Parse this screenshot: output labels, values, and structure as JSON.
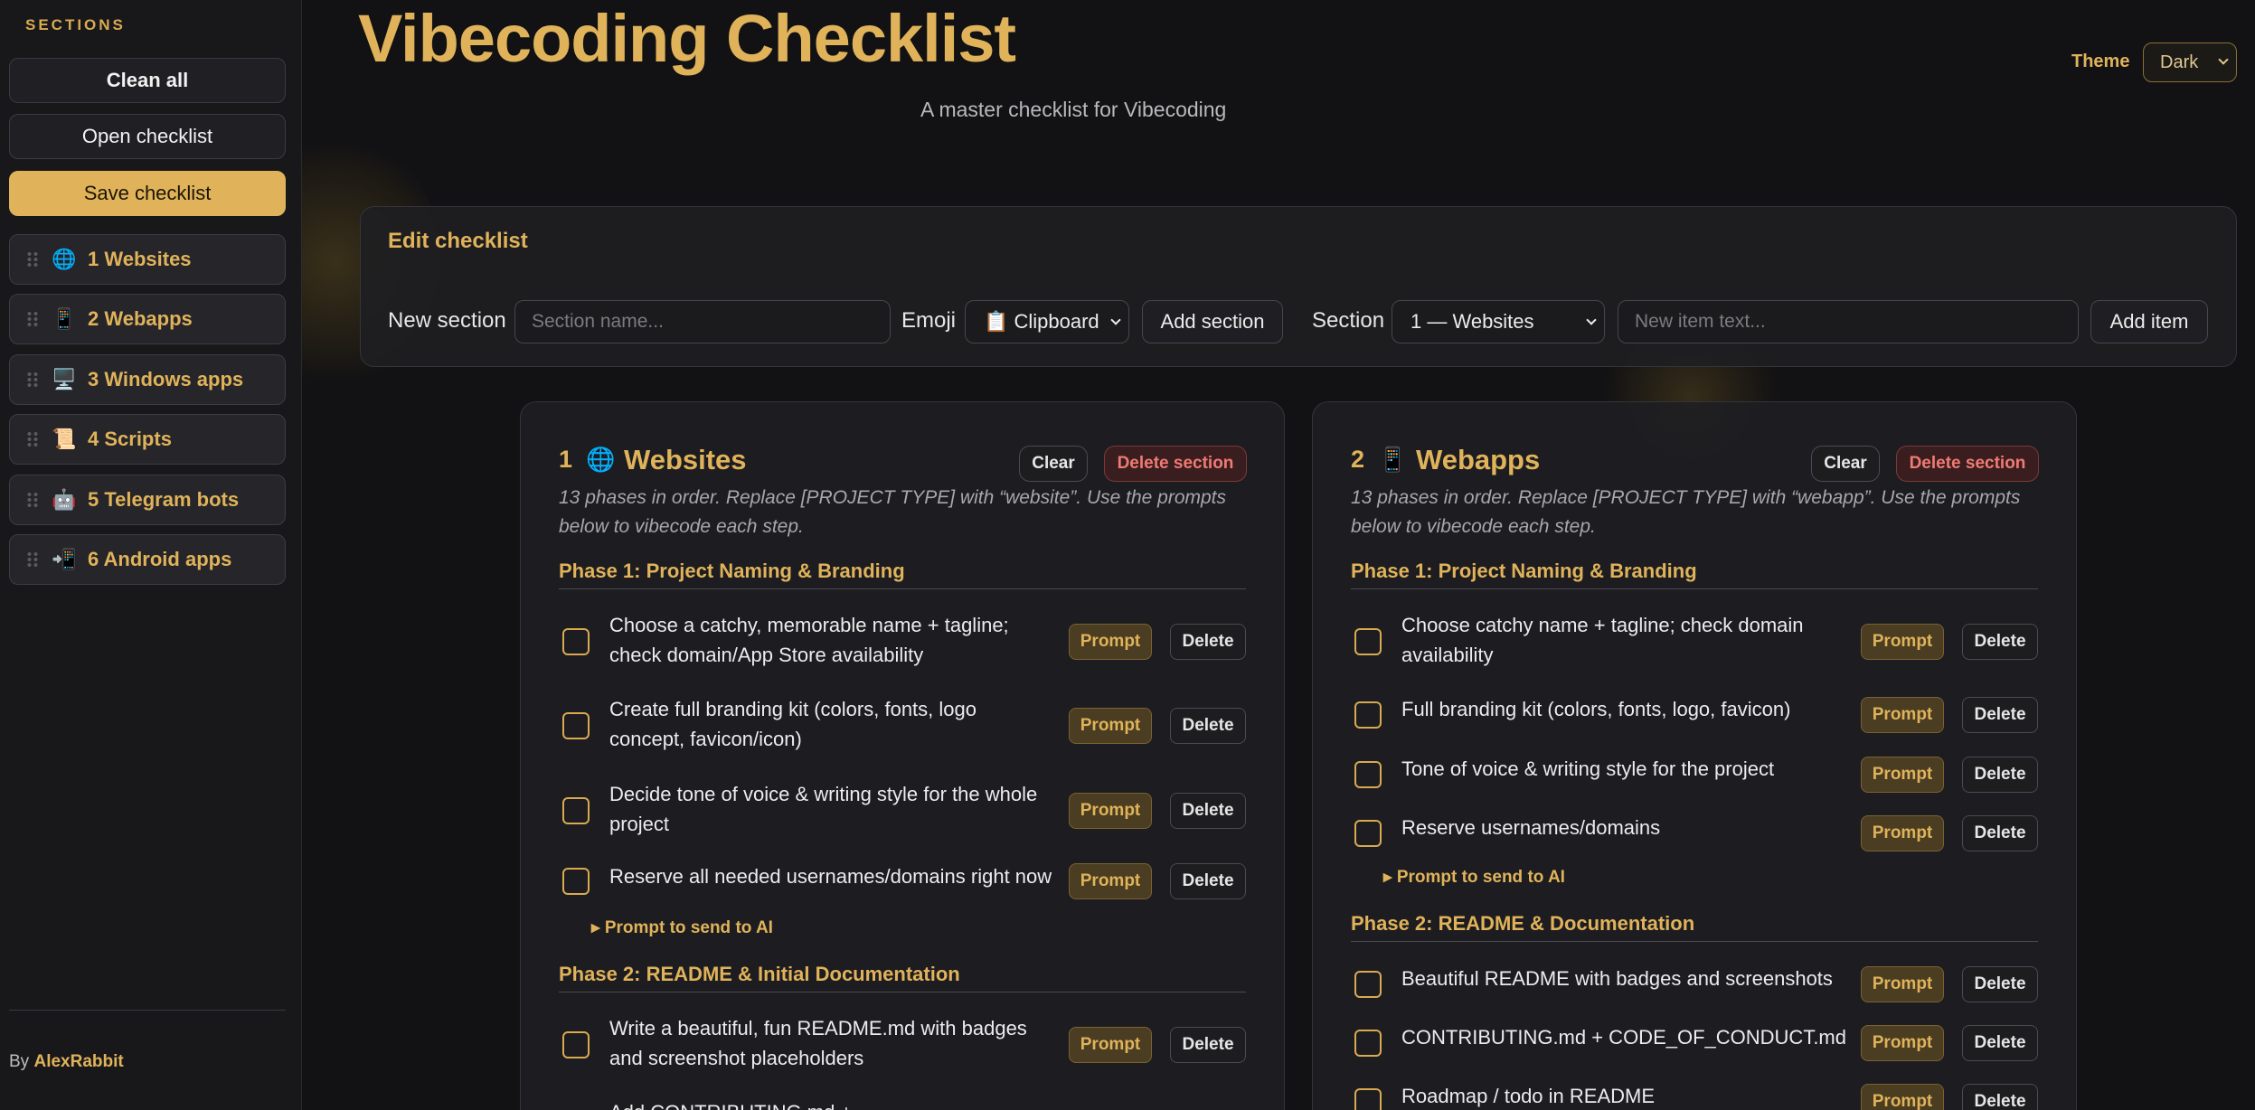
{
  "sidebar": {
    "title": "SECTIONS",
    "clean_all": "Clean all",
    "open_checklist": "Open checklist",
    "save_checklist": "Save checklist",
    "items": [
      {
        "emoji": "🌐",
        "label": "1 Websites"
      },
      {
        "emoji": "📱",
        "label": "2 Webapps"
      },
      {
        "emoji": "🖥️",
        "label": "3 Windows apps"
      },
      {
        "emoji": "📜",
        "label": "4 Scripts"
      },
      {
        "emoji": "🤖",
        "label": "5 Telegram bots"
      },
      {
        "emoji": "📲",
        "label": "6 Android apps"
      }
    ],
    "by_label": "By",
    "author": "AlexRabbit"
  },
  "header": {
    "title": "Vibecoding Checklist",
    "subtitle": "A master checklist for Vibecoding",
    "theme_label": "Theme",
    "theme_value": "Dark"
  },
  "edit": {
    "title": "Edit checklist",
    "new_section_label": "New section",
    "section_name_placeholder": "Section name...",
    "emoji_label": "Emoji",
    "emoji_value": "📋 Clipboard",
    "add_section": "Add section",
    "section_label": "Section",
    "section_value": "1 — Websites",
    "new_item_placeholder": "New item text...",
    "add_item": "Add item"
  },
  "common": {
    "clear": "Clear",
    "delete_section": "Delete section",
    "prompt": "Prompt",
    "delete": "Delete",
    "prompt_to_ai": "Prompt to send to AI"
  },
  "cards": [
    {
      "num": "1",
      "emoji": "🌐",
      "title": "Websites",
      "desc": "13 phases in order. Replace [PROJECT TYPE] with “website”. Use the prompts below to vibecode each step.",
      "phase1": "Phase 1: Project Naming & Branding",
      "items1": [
        "Choose a catchy, memorable name + tagline; check domain/App Store availability",
        "Create full branding kit (colors, fonts, logo concept, favicon/icon)",
        "Decide tone of voice & writing style for the whole project",
        "Reserve all needed usernames/domains right now"
      ],
      "phase2": "Phase 2: README & Initial Documentation",
      "items2": [
        "Write a beautiful, fun README.md with badges and screenshot placeholders",
        "Add CONTRIBUTING.md + …"
      ]
    },
    {
      "num": "2",
      "emoji": "📱",
      "title": "Webapps",
      "desc": "13 phases in order. Replace [PROJECT TYPE] with “webapp”. Use the prompts below to vibecode each step.",
      "phase1": "Phase 1: Project Naming & Branding",
      "items1": [
        "Choose catchy name + tagline; check domain availability",
        "Full branding kit (colors, fonts, logo, favicon)",
        "Tone of voice & writing style for the project",
        "Reserve usernames/domains"
      ],
      "phase2": "Phase 2: README & Documentation",
      "items2": [
        "Beautiful README with badges and screenshots",
        "CONTRIBUTING.md + CODE_OF_CONDUCT.md",
        "Roadmap / todo in README"
      ]
    }
  ],
  "colors": {
    "accent": "#e0b35a",
    "background": "#121214",
    "danger": "#f07a74"
  }
}
